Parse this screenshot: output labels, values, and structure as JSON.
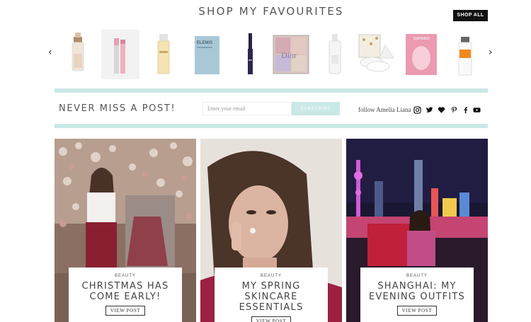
{
  "shop": {
    "title": "SHOP MY FAVOURITES",
    "shop_all_label": "SHOP ALL",
    "products": [
      {
        "name": "serum-dropper-bottle",
        "text": ""
      },
      {
        "name": "lip-glow-balm",
        "text": ""
      },
      {
        "name": "gold-essence-bottle",
        "text": ""
      },
      {
        "name": "elemis-sheet-mask",
        "text": "ELEMIS"
      },
      {
        "name": "mascara",
        "text": ""
      },
      {
        "name": "dior-highlighter-palette",
        "text": "Dior"
      },
      {
        "name": "white-serum-bottle",
        "text": ""
      },
      {
        "name": "cotton-pads-pack",
        "text": ""
      },
      {
        "name": "garnier-sheet-mask",
        "text": "GARNIER"
      },
      {
        "name": "orange-label-bottle",
        "text": ""
      }
    ]
  },
  "newsletter": {
    "heading": "NEVER MISS A POST!",
    "email_placeholder": "Enter your email",
    "subscribe_label": "SUBSCRIBE",
    "follow_label": "follow Amelia Liana",
    "social_icons": [
      "instagram-icon",
      "twitter-icon",
      "heart-icon",
      "pinterest-icon",
      "facebook-icon",
      "youtube-icon"
    ]
  },
  "posts": [
    {
      "category": "BEAUTY",
      "title": "CHRISTMAS HAS COME EARLY!",
      "button": "VIEW POST"
    },
    {
      "category": "BEAUTY",
      "title": "MY SPRING SKINCARE ESSENTIALS",
      "button": "VIEW POST"
    },
    {
      "category": "BEAUTY",
      "title": "SHANGHAI: MY EVENING OUTFITS",
      "button": "VIEW POST"
    }
  ],
  "colors": {
    "accent": "#c9e9e6",
    "dark": "#111111",
    "text": "#555555"
  }
}
